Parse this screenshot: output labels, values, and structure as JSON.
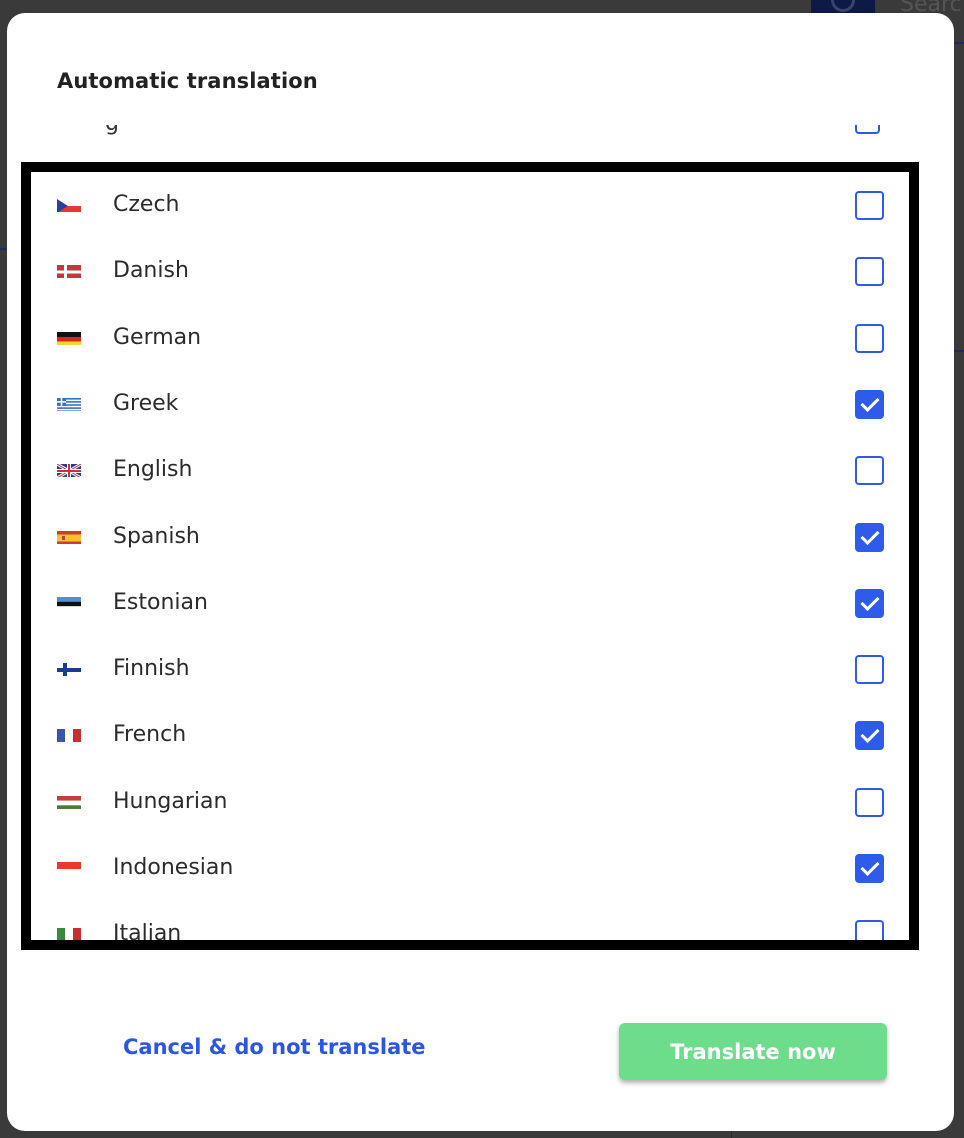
{
  "background": {
    "search_placeholder": "Searc"
  },
  "modal": {
    "title": "Automatic translation",
    "languages": [
      {
        "name": "Czech",
        "flag": "cz",
        "checked": false
      },
      {
        "name": "Danish",
        "flag": "dk",
        "checked": false
      },
      {
        "name": "German",
        "flag": "de",
        "checked": false
      },
      {
        "name": "Greek",
        "flag": "gr",
        "checked": true
      },
      {
        "name": "English",
        "flag": "gb",
        "checked": false
      },
      {
        "name": "Spanish",
        "flag": "es",
        "checked": true
      },
      {
        "name": "Estonian",
        "flag": "ee",
        "checked": true
      },
      {
        "name": "Finnish",
        "flag": "fi",
        "checked": false
      },
      {
        "name": "French",
        "flag": "fr",
        "checked": true
      },
      {
        "name": "Hungarian",
        "flag": "hu",
        "checked": false
      },
      {
        "name": "Indonesian",
        "flag": "id",
        "checked": true
      },
      {
        "name": "Italian",
        "flag": "it",
        "checked": false
      }
    ],
    "cancel_label": "Cancel & do not translate",
    "translate_label": "Translate now"
  },
  "colors": {
    "accent_blue": "#2f5bea",
    "translate_green": "#6ddc8b",
    "link_blue": "#2a55e5"
  }
}
